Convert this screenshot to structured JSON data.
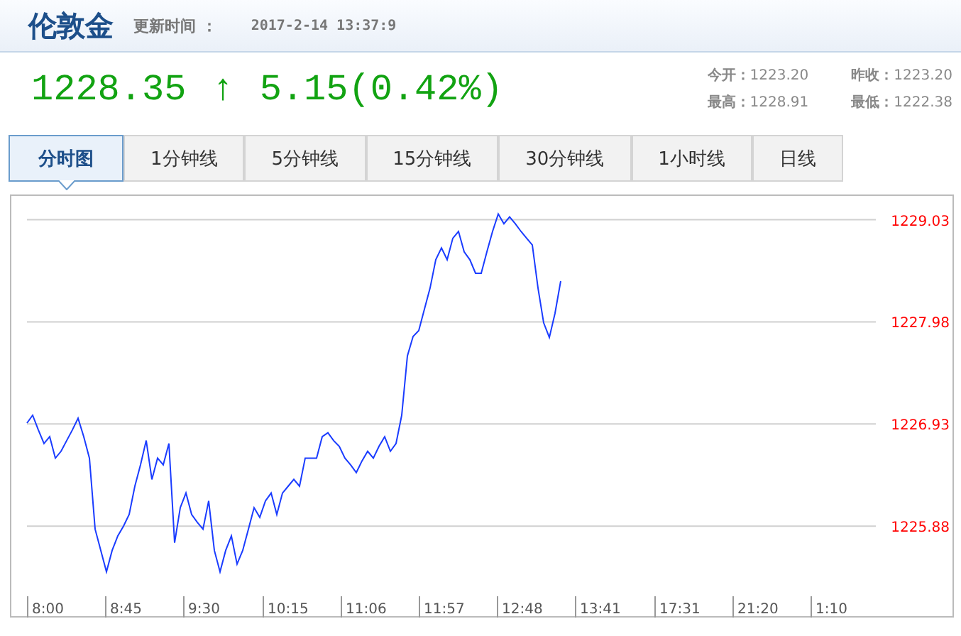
{
  "header": {
    "title": "伦敦金",
    "update_label": "更新时间 ：",
    "update_time": "2017-2-14 13:37:9"
  },
  "quote": {
    "price": "1228.35",
    "arrow": "↑",
    "change": "5.15(0.42%)"
  },
  "stats": [
    {
      "label": "今开：",
      "value": "1223.20"
    },
    {
      "label": "昨收：",
      "value": "1223.20"
    },
    {
      "label": "最高：",
      "value": "1228.91"
    },
    {
      "label": "最低：",
      "value": "1222.38"
    }
  ],
  "tabs": [
    {
      "label": "分时图",
      "selected": true
    },
    {
      "label": "1分钟线",
      "selected": false
    },
    {
      "label": "5分钟线",
      "selected": false
    },
    {
      "label": "15分钟线",
      "selected": false
    },
    {
      "label": "30分钟线",
      "selected": false
    },
    {
      "label": "1小时线",
      "selected": false
    },
    {
      "label": "日线",
      "selected": false
    }
  ],
  "chart": {
    "time_labels": [
      "8:00",
      "8:45",
      "9:30",
      "10:15",
      "11:06",
      "11:57",
      "12:48",
      "13:41",
      "17:31",
      "21:20",
      "1:10"
    ],
    "chart_data": {
      "type": "line",
      "grid": true,
      "ylim": [
        1224.94,
        1229.29
      ],
      "yticks": [
        {
          "value": 1225.88,
          "label": "1225.88"
        },
        {
          "value": 1226.93,
          "label": "1226.93"
        },
        {
          "value": 1227.98,
          "label": "1227.98"
        },
        {
          "value": 1229.03,
          "label": "1229.03"
        }
      ],
      "series": [
        {
          "color": "#1a3cff",
          "values": [
            1226.94,
            1227.02,
            1226.87,
            1226.73,
            1226.8,
            1226.58,
            1226.65,
            1226.76,
            1226.87,
            1226.99,
            1226.8,
            1226.58,
            1225.85,
            1225.63,
            1225.41,
            1225.63,
            1225.78,
            1225.88,
            1226.0,
            1226.29,
            1226.51,
            1226.76,
            1226.36,
            1226.58,
            1226.51,
            1226.73,
            1225.71,
            1226.07,
            1226.22,
            1226.0,
            1225.92,
            1225.85,
            1226.14,
            1225.63,
            1225.41,
            1225.63,
            1225.78,
            1225.49,
            1225.63,
            1225.85,
            1226.07,
            1225.97,
            1226.14,
            1226.22,
            1226.0,
            1226.22,
            1226.29,
            1226.36,
            1226.29,
            1226.58,
            1226.58,
            1226.58,
            1226.8,
            1226.84,
            1226.76,
            1226.7,
            1226.58,
            1226.51,
            1226.43,
            1226.55,
            1226.65,
            1226.58,
            1226.7,
            1226.8,
            1226.65,
            1226.73,
            1227.02,
            1227.63,
            1227.83,
            1227.89,
            1228.11,
            1228.33,
            1228.62,
            1228.74,
            1228.62,
            1228.84,
            1228.91,
            1228.7,
            1228.62,
            1228.48,
            1228.48,
            1228.7,
            1228.91,
            1229.09,
            1228.99,
            1229.06,
            1228.99,
            1228.91,
            1228.84,
            1228.77,
            1228.33,
            1227.97,
            1227.82,
            1228.07,
            1228.4
          ]
        }
      ]
    }
  }
}
